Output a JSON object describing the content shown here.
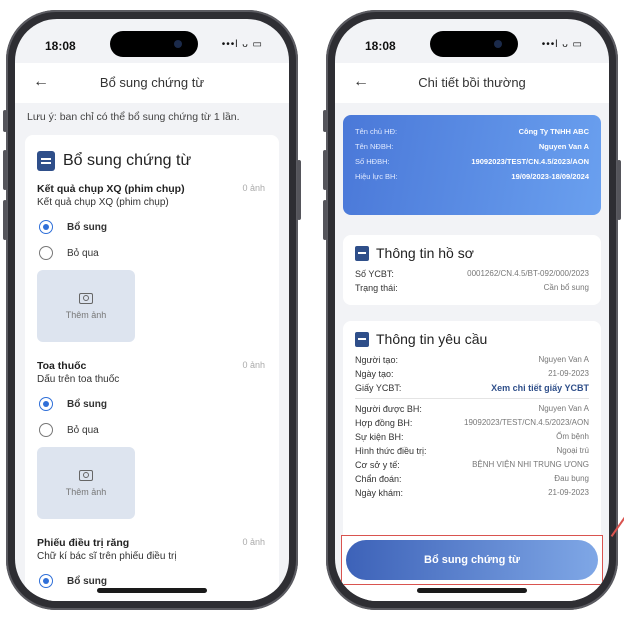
{
  "left": {
    "time": "18:08",
    "signal": "•••l ᴗ ▭",
    "title": "Bổ sung chứng từ",
    "note": "Lưu ý: ban chỉ có thể bổ sung chứng từ 1 lần.",
    "card_title": "Bổ sung chứng từ",
    "sections": [
      {
        "title": "Kết quả chụp XQ (phim chụp)",
        "subtitle": "Kết quả chụp XQ (phim chụp)",
        "count": "0 ảnh",
        "opt_yes": "Bổ sung",
        "opt_no": "Bỏ qua",
        "upload": "Thêm ảnh"
      },
      {
        "title": "Toa thuốc",
        "subtitle": "Dấu trên toa thuốc",
        "count": "0 ảnh",
        "opt_yes": "Bổ sung",
        "opt_no": "Bỏ qua",
        "upload": "Thêm ảnh"
      },
      {
        "title": "Phiếu điều trị răng",
        "subtitle": "Chữ kí bác sĩ trên phiếu điều trị",
        "count": "0 ảnh",
        "opt_yes": "Bổ sung"
      }
    ]
  },
  "right": {
    "time": "18:08",
    "signal": "•••l ᴗ ▭",
    "title": "Chi tiết bồi thường",
    "hero": [
      {
        "k": "Tên chủ HĐ:",
        "v": "Công Ty TNHH ABC"
      },
      {
        "k": "Tên NĐBH:",
        "v": "Nguyen Van A"
      },
      {
        "k": "Số HĐBH:",
        "v": "19092023/TEST/CN.4.5/2023/AON"
      },
      {
        "k": "Hiệu lực BH:",
        "v": "19/09/2023-18/09/2024"
      }
    ],
    "profile_title": "Thông tin hồ sơ",
    "profile": [
      {
        "k": "Số YCBT:",
        "v": "0001262/CN.4.5/BT-092/000/2023"
      },
      {
        "k": "Trạng thái:",
        "v": "Cần bổ sung"
      }
    ],
    "request_title": "Thông tin yêu cầu",
    "request_a": [
      {
        "k": "Người tạo:",
        "v": "Nguyen Van A"
      },
      {
        "k": "Ngày tạo:",
        "v": "21-09-2023"
      }
    ],
    "request_link": {
      "k": "Giấy YCBT:",
      "v": "Xem chi tiết giấy YCBT"
    },
    "request_b": [
      {
        "k": "Người được BH:",
        "v": "Nguyen Van A"
      },
      {
        "k": "Hợp đồng BH:",
        "v": "19092023/TEST/CN.4.5/2023/AON"
      },
      {
        "k": "Sự kiện BH:",
        "v": "Ốm bệnh"
      },
      {
        "k": "Hình thức điều trị:",
        "v": "Ngoại trú"
      },
      {
        "k": "Cơ sở y tế:",
        "v": "BỆNH VIỆN NHI TRUNG ƯONG"
      },
      {
        "k": "Chẩn đoán:",
        "v": "Đau bụng"
      },
      {
        "k": "Ngày khám:",
        "v": "21-09-2023"
      }
    ],
    "cta": "Bổ sung chứng từ"
  }
}
